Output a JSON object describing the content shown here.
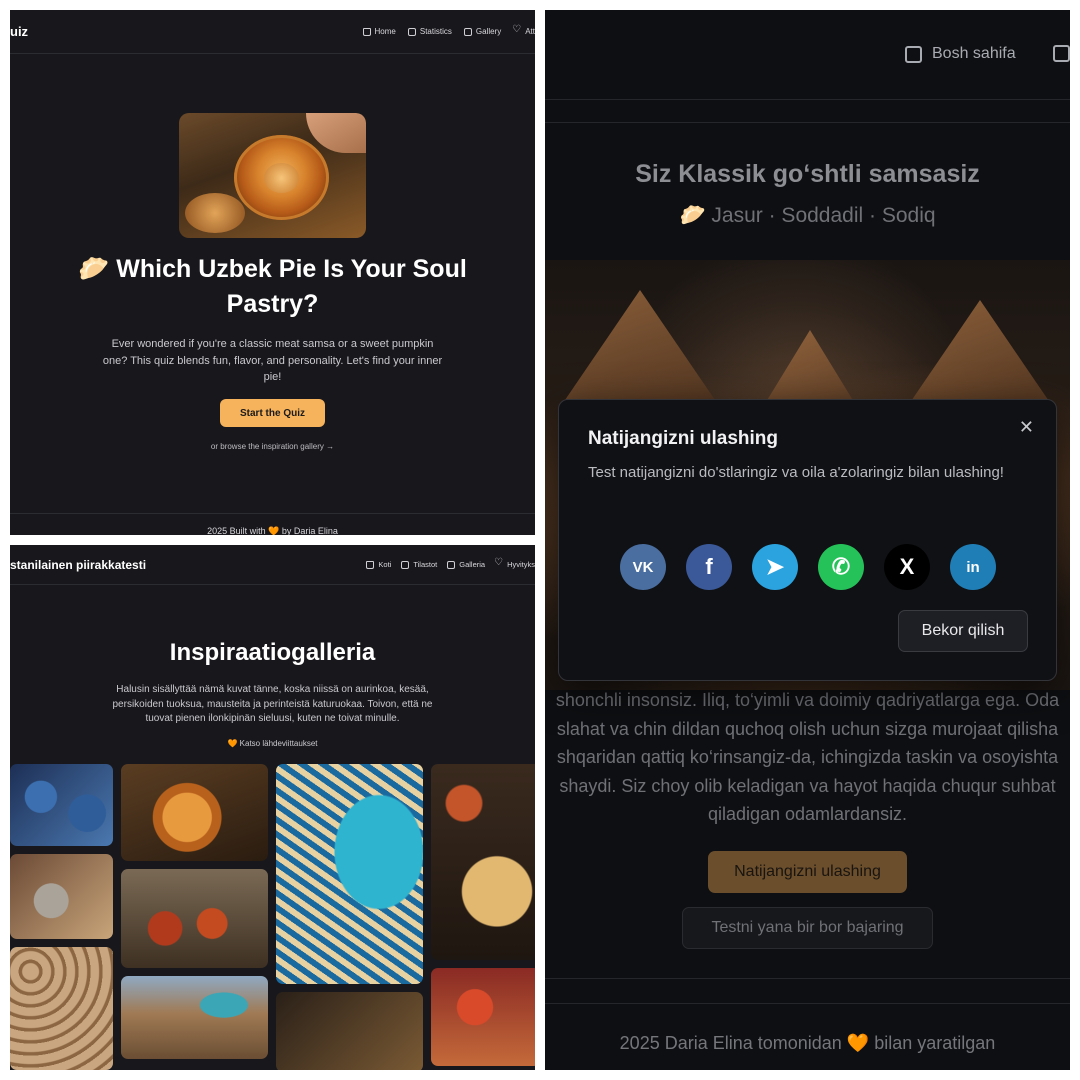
{
  "quiz_home": {
    "brand": "uiz",
    "nav": [
      "Home",
      "Statistics",
      "Gallery",
      "Att"
    ],
    "title": "🥟 Which Uzbek Pie Is Your Soul Pastry?",
    "description": "Ever wondered if you're a classic meat samsa or a sweet pumpkin one? This quiz blends fun, flavor, and personality. Let's find your inner pie!",
    "start_button": "Start the Quiz",
    "browse_link": "or browse the inspiration gallery →",
    "footer": "2025 Built with 🧡 by Daria Elina"
  },
  "gallery": {
    "brand": "stanilainen piirakkatesti",
    "nav": [
      "Koti",
      "Tilastot",
      "Galleria",
      "Hyvityks"
    ],
    "title": "Inspiraatiogalleria",
    "description": "Halusin sisällyttää nämä kuvat tänne, koska niissä on aurinkoa, kesää, persikoiden tuoksua, mausteita ja perinteistä katuruokaa. Toivon, että ne tuovat pienen ilonkipinän sieluusi, kuten ne toivat minulle.",
    "credits_link": "🧡 Katso lähdeviittaukset"
  },
  "result": {
    "nav": [
      "Bosh sahifa"
    ],
    "title": "Siz Klassik go‘shtli samsasiz",
    "traits": "🥟 Jasur · Soddadil · Sodiq",
    "body_lines": [
      "shonchli insonsiz. Iliq, to‘yimli va doimiy qadriyatlarga ega. Oda",
      "slahat va chin dildan quchoq olish uchun sizga murojaat qilisha",
      "shqaridan qattiq ko‘rinsangiz-da, ichingizda taskin va osoyishta",
      "shaydi. Siz choy olib keladigan va hayot haqida chuqur suhbat",
      "qiladigan odamlardansiz."
    ],
    "share_button": "Natijangizni ulashing",
    "retry_button": "Testni yana bir bor bajaring",
    "footer": "2025 Daria Elina tomonidan 🧡 bilan yaratilgan",
    "modal": {
      "title": "Natijangizni ulashing",
      "description": "Test natijangizni do'stlaringiz va oila a'zolaringiz bilan ulashing!",
      "close": "✕",
      "cancel_button": "Bekor qilish",
      "socials": [
        {
          "name": "vk-icon",
          "glyph": "VK",
          "color": "#4a6ea0"
        },
        {
          "name": "facebook-icon",
          "glyph": "f",
          "color": "#3b5998"
        },
        {
          "name": "telegram-icon",
          "glyph": "➤",
          "color": "#2aa3df"
        },
        {
          "name": "whatsapp-icon",
          "glyph": "✆",
          "color": "#25c25a"
        },
        {
          "name": "x-icon",
          "glyph": "X",
          "color": "#000000"
        },
        {
          "name": "linkedin-icon",
          "glyph": "in",
          "color": "#1f7eb5"
        }
      ]
    }
  }
}
